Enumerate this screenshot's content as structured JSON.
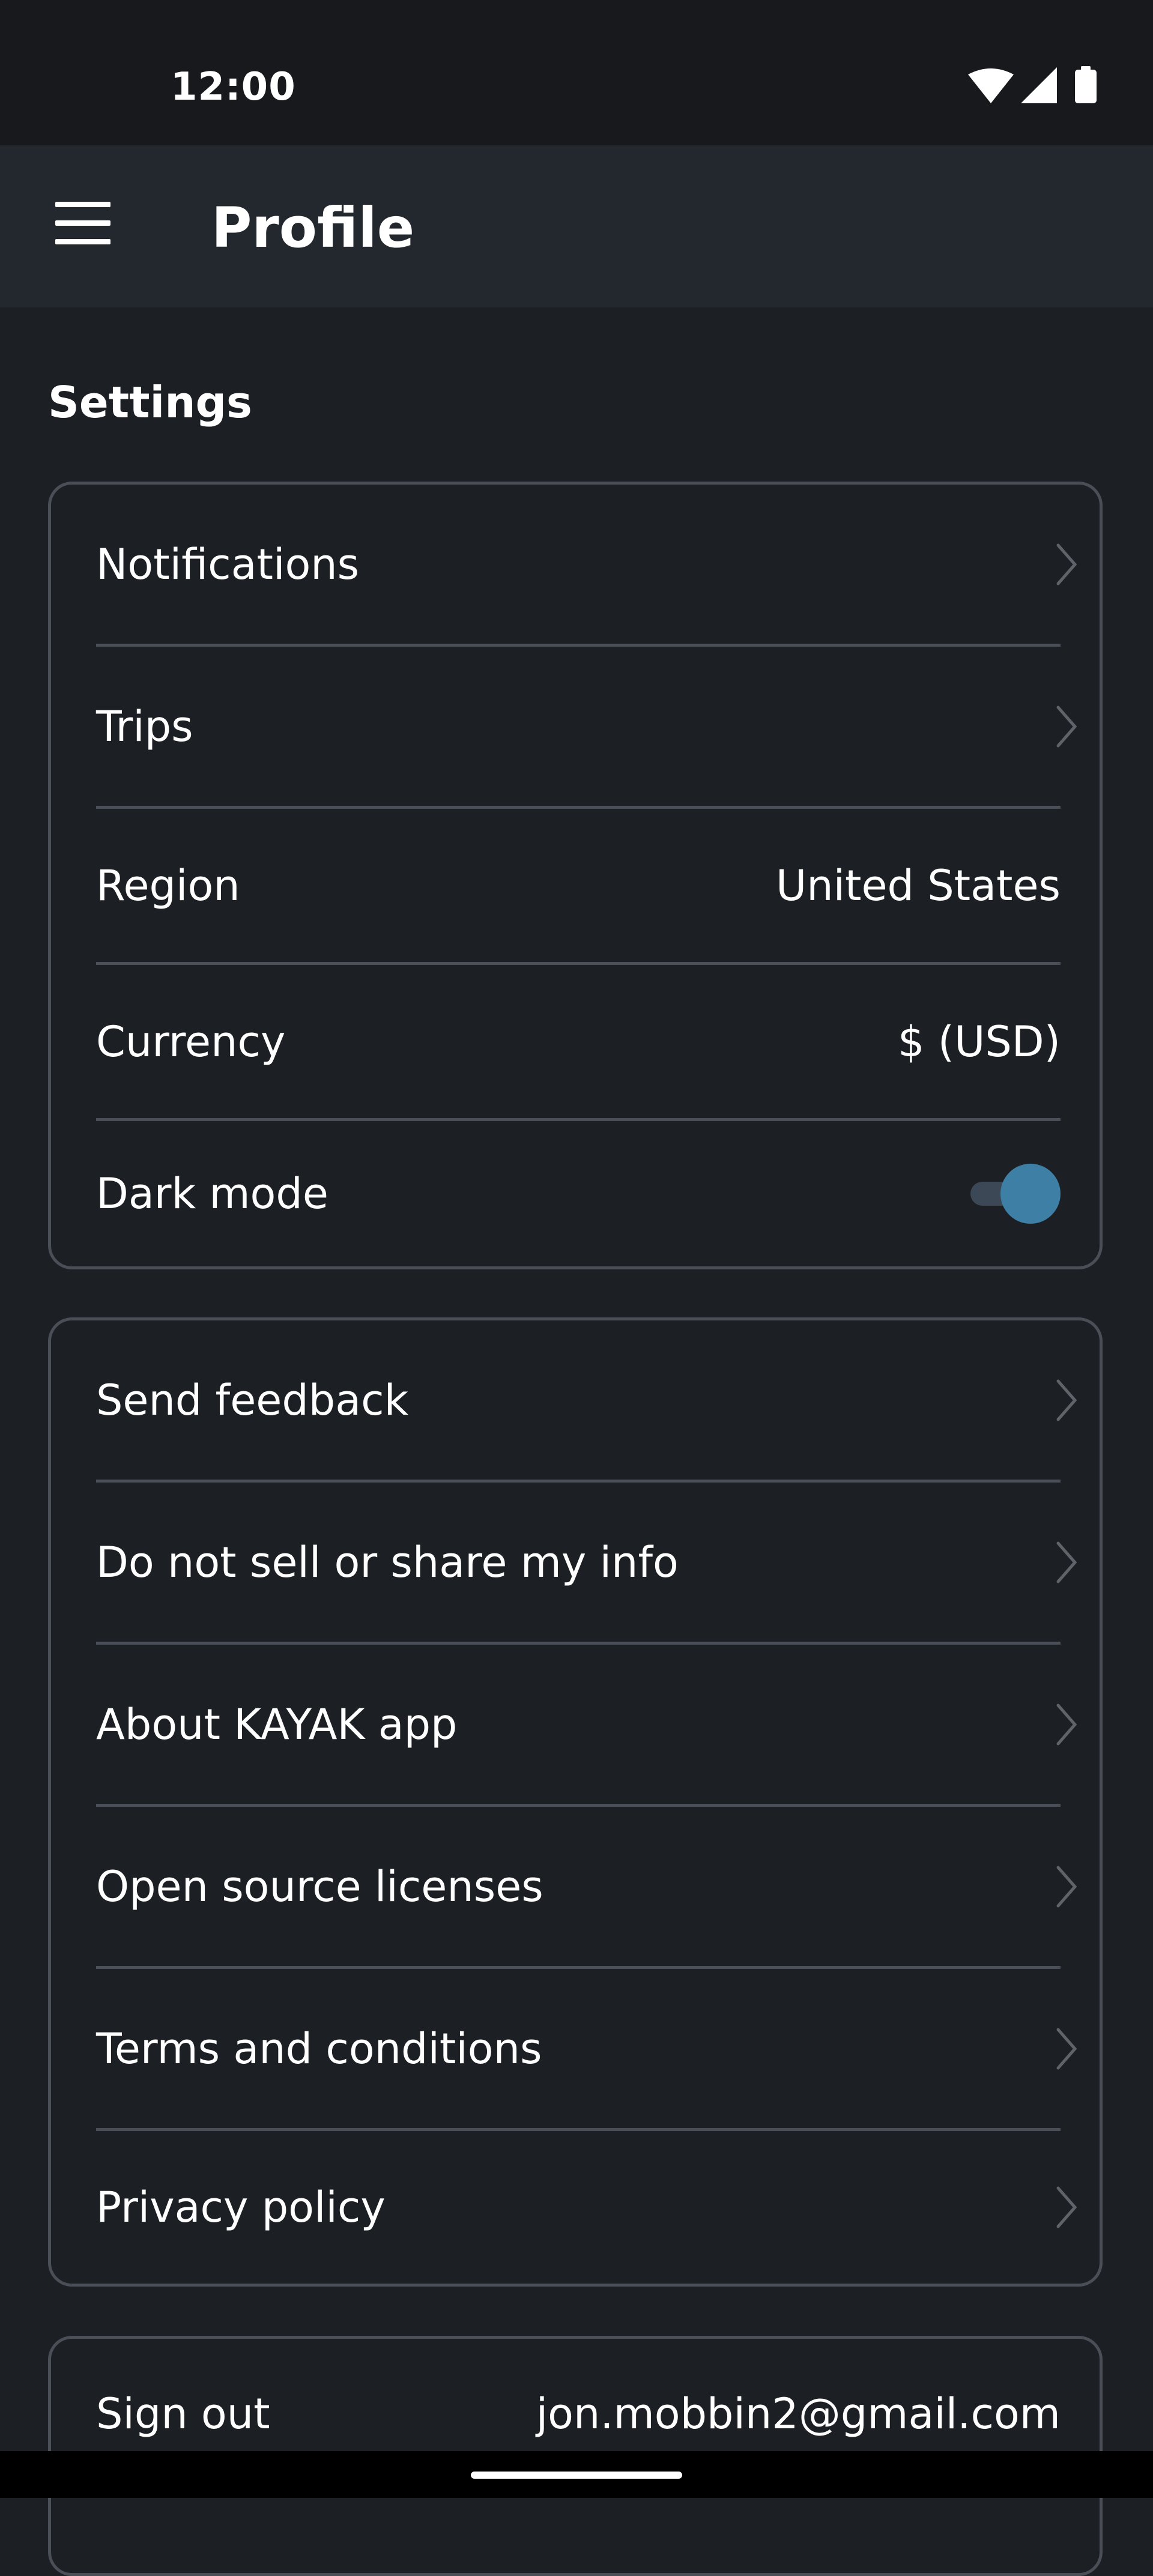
{
  "status_bar": {
    "time": "12:00",
    "icons": [
      "wifi-icon",
      "cell-signal-icon",
      "battery-icon"
    ]
  },
  "app_bar": {
    "title": "Profile",
    "menu_icon": "hamburger-menu-icon"
  },
  "settings": {
    "heading": "Settings",
    "notifications_label": "Notifications",
    "trips_label": "Trips",
    "region_label": "Region",
    "region_value": "United States",
    "currency_label": "Currency",
    "currency_value": "$ (USD)",
    "dark_mode_label": "Dark mode",
    "dark_mode_on": true
  },
  "info": {
    "send_feedback": "Send feedback",
    "do_not_sell": "Do not sell or share my info",
    "about_app": "About KAYAK app",
    "open_source": "Open source licenses",
    "terms": "Terms and conditions",
    "privacy": "Privacy policy"
  },
  "account": {
    "sign_out_label": "Sign out",
    "email": "jon.mobbin2@gmail.com"
  },
  "colors": {
    "background": "#1c1f23",
    "app_bar": "#23282f",
    "status_bar": "#17191c",
    "card_border": "#4a4f57",
    "toggle_accent": "#3e7fa6",
    "chevron": "#5f646b"
  }
}
